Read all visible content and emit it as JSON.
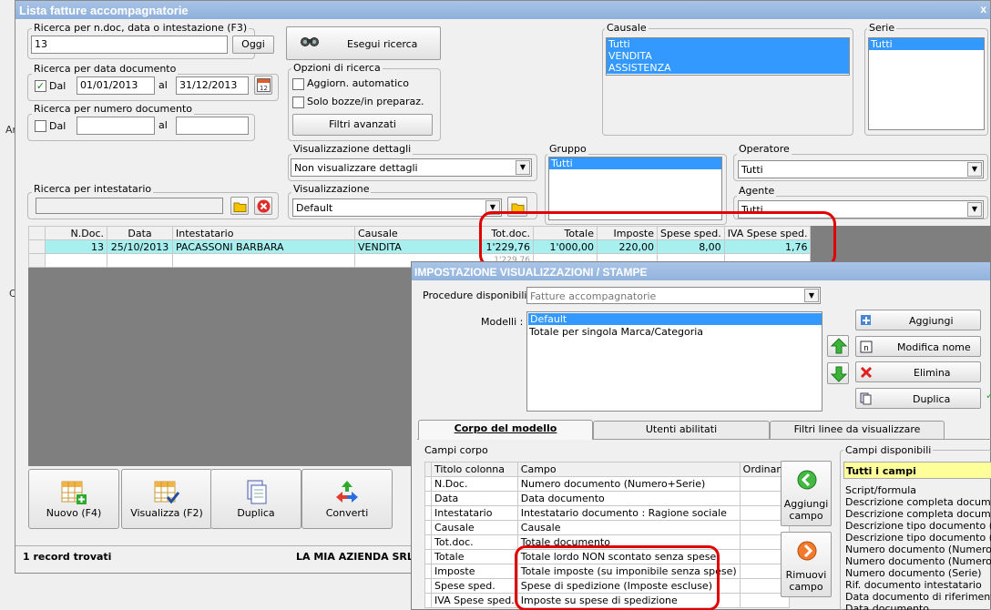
{
  "window": {
    "title": "Lista fatture accompagnatorie",
    "close": "x"
  },
  "bg": {
    "ar": "Ar",
    "c": "C"
  },
  "search": {
    "legend": "Ricerca per n.doc, data o intestazione (F3)",
    "value": "13",
    "today": "Oggi",
    "run": "Esegui ricerca"
  },
  "date_search": {
    "legend": "Ricerca per data documento",
    "dal": "Dal",
    "from": "01/01/2013",
    "al": "al",
    "to": "31/12/2013",
    "calendar_day": "12"
  },
  "num_search": {
    "legend": "Ricerca per numero documento",
    "dal": "Dal",
    "al": "al"
  },
  "options": {
    "legend": "Opzioni di ricerca",
    "auto": "Aggiorn. automatico",
    "drafts": "Solo bozze/in preparaz.",
    "advanced": "Filtri avanzati"
  },
  "causale": {
    "legend": "Causale",
    "items": [
      "Tutti",
      "VENDITA",
      "ASSISTENZA"
    ]
  },
  "serie": {
    "legend": "Serie",
    "items": [
      "Tutti"
    ]
  },
  "details": {
    "legend": "Visualizzazione dettagli",
    "value": "Non visualizzare dettagli"
  },
  "gruppo": {
    "legend": "Gruppo",
    "items": [
      "Tutti"
    ]
  },
  "operatore": {
    "legend": "Operatore",
    "value": "Tutti"
  },
  "intestatario": {
    "legend": "Ricerca per intestatario"
  },
  "view": {
    "legend": "Visualizzazione",
    "value": "Default"
  },
  "agente": {
    "legend": "Agente",
    "value": "Tutti"
  },
  "grid": {
    "columns": [
      "N.Doc.",
      "Data",
      "Intestatario",
      "Causale",
      "Tot.doc.",
      "Totale",
      "Imposte",
      "Spese sped.",
      "IVA Spese sped."
    ],
    "rows": [
      [
        "13",
        "25/10/2013",
        "PACASSONI BARBARA",
        "VENDITA",
        "1'229,76",
        "1'000,00",
        "220,00",
        "8,00",
        "1,76"
      ]
    ],
    "footer_partial": "1'229,76"
  },
  "actions": [
    "Nuovo (F4)",
    "Visualizza (F2)",
    "Duplica",
    "Converti"
  ],
  "status": {
    "records": "1 record trovati",
    "company": "LA MIA AZIENDA SRL"
  },
  "dialog": {
    "title": "IMPOSTAZIONE VISUALIZZAZIONI / STAMPE",
    "procedure_label": "Procedure disponibili :",
    "procedure_value": "Fatture accompagnatorie",
    "models_label": "Modelli :",
    "models": [
      "Default",
      "Totale per singola Marca/Categoria"
    ],
    "buttons": {
      "add": "Aggiungi",
      "rename": "Modifica nome",
      "delete": "Elimina",
      "duplicate": "Duplica"
    },
    "tabs": [
      "Corpo del modello",
      "Utenti abilitati",
      "Filtri linee da visualizzare"
    ],
    "body_label": "Campi corpo",
    "body_columns": [
      "Titolo colonna",
      "Campo",
      "Ordinam"
    ],
    "body_rows": [
      [
        "N.Doc.",
        "Numero documento (Numero+Serie)"
      ],
      [
        "Data",
        "Data documento"
      ],
      [
        "Intestatario",
        "Intestatario documento : Ragione sociale"
      ],
      [
        "Causale",
        "Causale"
      ],
      [
        "Tot.doc.",
        "Totale documento"
      ],
      [
        "Totale",
        "Totale lordo NON scontato senza spese"
      ],
      [
        "Imposte",
        "Totale imposte (su imponibile senza spese)"
      ],
      [
        "Spese sped.",
        "Spese di spedizione (Imposte escluse)"
      ],
      [
        "IVA Spese sped.",
        "Imposte su spese di spedizione"
      ]
    ],
    "add_field": "Aggiungi campo",
    "remove_field": "Rimuovi campo",
    "available_label": "Campi disponibili",
    "available_header": "Tutti i campi",
    "available": [
      "Script/formula",
      "Descrizione completa documento (",
      "Descrizione completa documento (",
      "Descrizione tipo documento (este",
      "Descrizione tipo documento (abbr",
      "Numero documento (Numero+Seri",
      "Numero documento (Numero)",
      "Numero documento (Serie)",
      "Rif. documento intestatario",
      "Data documento di riferimento int",
      "Data documento"
    ]
  }
}
